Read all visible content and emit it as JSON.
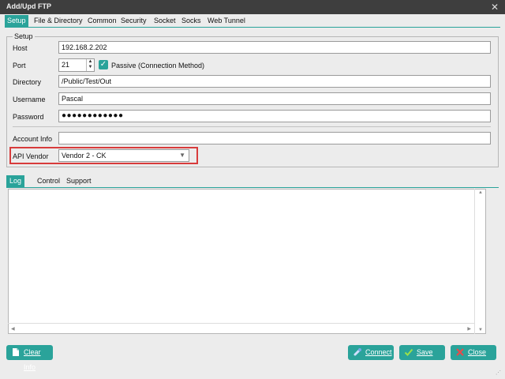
{
  "window": {
    "title": "Add/Upd FTP"
  },
  "tabs": [
    "Setup",
    "File & Directory",
    "Common",
    "Security",
    "Socket",
    "Socks",
    "Web Tunnel"
  ],
  "setup": {
    "legend": "Setup",
    "host": {
      "label": "Host",
      "value": "192.168.2.202"
    },
    "port": {
      "label": "Port",
      "value": "21"
    },
    "passive": {
      "label": "Passive (Connection Method)",
      "checked": true
    },
    "directory": {
      "label": "Directory",
      "value": "/Public/Test/Out"
    },
    "username": {
      "label": "Username",
      "value": "Pascal"
    },
    "password": {
      "label": "Password",
      "value": "●●●●●●●●●●●●"
    },
    "account_info": {
      "label": "Account Info",
      "value": ""
    },
    "api_vendor": {
      "label": "API Vendor",
      "value": "Vendor 2 - CK"
    }
  },
  "subtabs": [
    "Log",
    "Control",
    "Support"
  ],
  "buttons": {
    "clear_info": "Clear Info",
    "connect": "Connect",
    "save": "Save",
    "close": "Close"
  },
  "colors": {
    "accent": "#2aa39a",
    "highlight": "#d83b3b",
    "titlebar": "#3e3e3e"
  }
}
